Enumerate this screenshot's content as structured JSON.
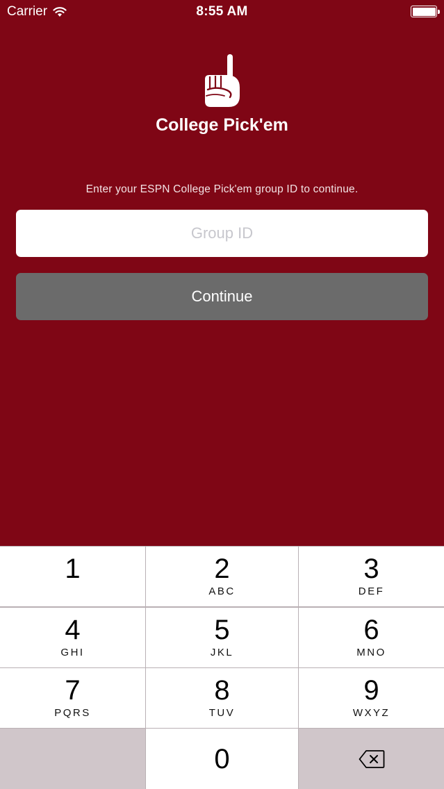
{
  "status_bar": {
    "carrier": "Carrier",
    "time": "8:55 AM",
    "wifi_icon": "wifi-icon",
    "battery_icon": "battery-icon"
  },
  "app": {
    "logo_icon": "number-one-finger-icon",
    "title": "College Pick'em",
    "instructions": "Enter your ESPN College Pick'em group ID to continue."
  },
  "form": {
    "group_id_placeholder": "Group ID",
    "group_id_value": "",
    "continue_label": "Continue"
  },
  "keypad": {
    "keys": [
      {
        "digit": "1",
        "letters": ""
      },
      {
        "digit": "2",
        "letters": "ABC"
      },
      {
        "digit": "3",
        "letters": "DEF"
      },
      {
        "digit": "4",
        "letters": "GHI"
      },
      {
        "digit": "5",
        "letters": "JKL"
      },
      {
        "digit": "6",
        "letters": "MNO"
      },
      {
        "digit": "7",
        "letters": "PQRS"
      },
      {
        "digit": "8",
        "letters": "TUV"
      },
      {
        "digit": "9",
        "letters": "WXYZ"
      },
      {
        "digit": "0",
        "letters": ""
      }
    ],
    "delete_icon": "backspace-icon"
  },
  "colors": {
    "background": "#7f0615",
    "button_disabled": "#6b6b6b",
    "keypad_key": "#ffffff",
    "keypad_dark_key": "#d0c6ca"
  }
}
